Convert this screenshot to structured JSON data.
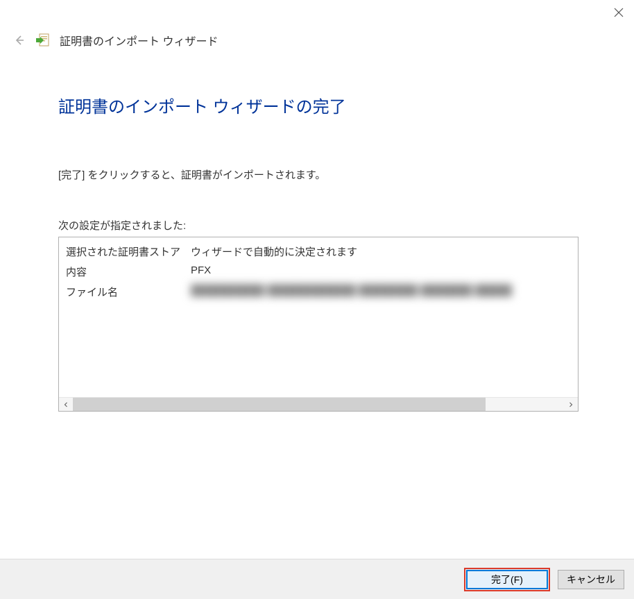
{
  "header": {
    "wizard_title": "証明書のインポート ウィザード"
  },
  "main": {
    "heading": "証明書のインポート ウィザードの完了",
    "instruction": "[完了] をクリックすると、証明書がインポートされます。",
    "settings_label": "次の設定が指定されました:",
    "rows": [
      {
        "key": "選択された証明書ストア",
        "value": "ウィザードで自動的に決定されます"
      },
      {
        "key": "内容",
        "value": "PFX"
      },
      {
        "key": "ファイル名",
        "value": "██████████ ████████████ ████████ ███████ █████",
        "blurred": true
      }
    ]
  },
  "footer": {
    "finish_label": "完了(F)",
    "cancel_label": "キャンセル"
  }
}
